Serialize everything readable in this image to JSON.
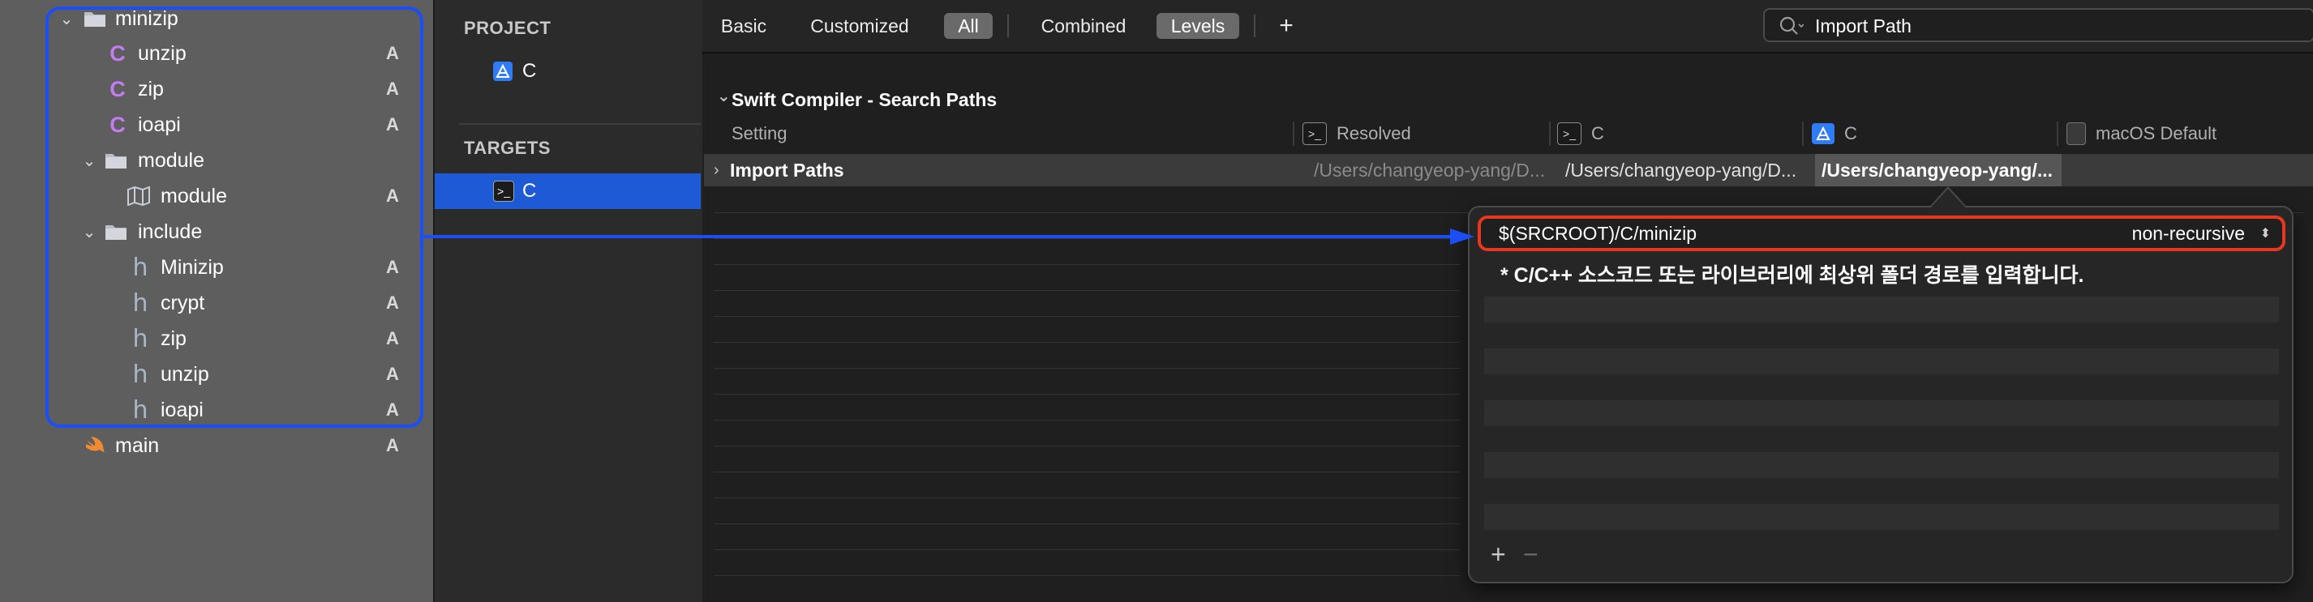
{
  "navigator": {
    "items": [
      {
        "label": "minizip",
        "type": "folder",
        "expanded": true,
        "badge": ""
      },
      {
        "label": "unzip",
        "type": "c",
        "badge": "A"
      },
      {
        "label": "zip",
        "type": "c",
        "badge": "A"
      },
      {
        "label": "ioapi",
        "type": "c",
        "badge": "A"
      },
      {
        "label": "module",
        "type": "folder",
        "expanded": true,
        "badge": ""
      },
      {
        "label": "module",
        "type": "modulemap",
        "badge": "A"
      },
      {
        "label": "include",
        "type": "folder",
        "expanded": true,
        "badge": ""
      },
      {
        "label": "Minizip",
        "type": "h",
        "badge": "A"
      },
      {
        "label": "crypt",
        "type": "h",
        "badge": "A"
      },
      {
        "label": "zip",
        "type": "h",
        "badge": "A"
      },
      {
        "label": "unzip",
        "type": "h",
        "badge": "A"
      },
      {
        "label": "ioapi",
        "type": "h",
        "badge": "A"
      },
      {
        "label": "main",
        "type": "swift",
        "badge": "A"
      }
    ]
  },
  "project_pane": {
    "project_header": "PROJECT",
    "project_item": "C",
    "targets_header": "TARGETS",
    "target_item": "C"
  },
  "filter_bar": {
    "basic": "Basic",
    "customized": "Customized",
    "all": "All",
    "combined": "Combined",
    "levels": "Levels",
    "add": "+",
    "search_value": "Import Path"
  },
  "settings": {
    "section_title": "Swift Compiler - Search Paths",
    "columns": {
      "setting": "Setting",
      "resolved": "Resolved",
      "target": "C",
      "project": "C",
      "default": "macOS Default"
    },
    "row": {
      "name": "Import Paths",
      "resolved": "/Users/changyeop-yang/D...",
      "target": "/Users/changyeop-yang/D...",
      "project": "/Users/changyeop-yang/..."
    }
  },
  "popover": {
    "path_value": "$(SRCROOT)/C/minizip",
    "recursion": "non-recursive",
    "annotation": "* C/C++ 소스코드 또는 라이브러리에 최상위 폴더 경로를 입력합니다.",
    "add": "+",
    "remove": "−"
  },
  "colors": {
    "highlight_blue": "#1b4ff5",
    "highlight_red": "#e8371f",
    "selection": "#1f5ad6"
  }
}
